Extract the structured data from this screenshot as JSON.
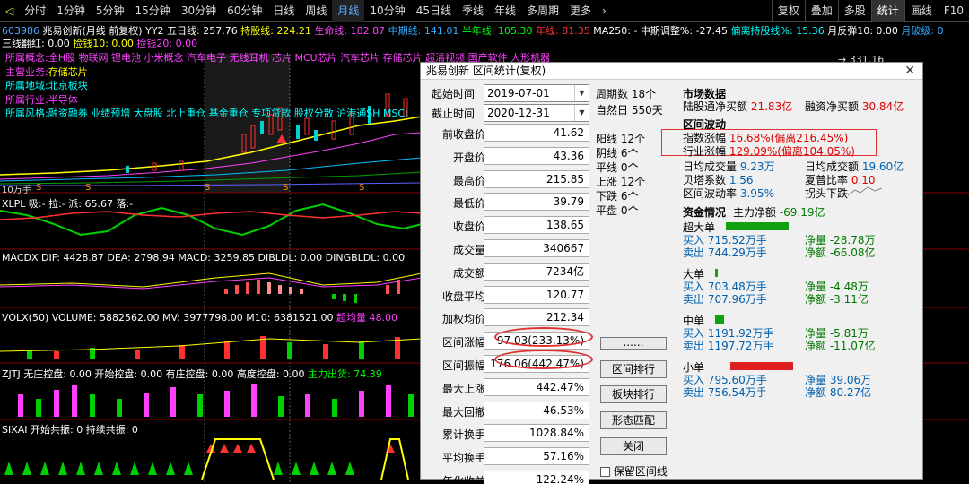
{
  "toolbar": {
    "tabs": [
      "分时",
      "1分钟",
      "5分钟",
      "15分钟",
      "30分钟",
      "60分钟",
      "日线",
      "周线",
      "月线",
      "10分钟",
      "45日线",
      "季线",
      "年线",
      "多周期",
      "更多"
    ],
    "active": "月线",
    "right": [
      "复权",
      "叠加",
      "多股",
      "统计",
      "画线",
      "F10"
    ]
  },
  "stock": {
    "code": "603986",
    "name": "兆易创新(月线 前复权)",
    "ma_label": "YY2",
    "ma5": "五日线: 257.76",
    "hold": "持股线: 224.21",
    "life": "生命线: 182.87",
    "mid": "中期线: 141.01",
    "half": "半年线: 105.30",
    "year": "年线: 81.35",
    "ma250": "MA250: - 中期调整%: -27.45",
    "bias": "偏离持股线%: 15.36",
    "month_reverse": "月反弹10: 0.00",
    "brk": "月破级: 0",
    "signal": "三线翻红: 0.00",
    "pick": "捡钱10: 0.00",
    "pick20": "捡钱20: 0.00",
    "price_mark": "331.16"
  },
  "info": {
    "concept_label": "所属概念:",
    "concept": "全H股 物联网 锂电池 小米概念 汽车电子 无线耳机 芯片 MCU芯片 汽车芯片 存储芯片 超清视频 国产软件 人形机器",
    "biz_label": "主营业务:",
    "biz": "存储芯片",
    "region_label": "所属地域:",
    "region": "北京板块",
    "industry_label": "所属行业:",
    "industry": "半导体",
    "style_label": "所属风格:",
    "style": "融资融券 业绩预增 大盘股 北上重仓 基金重仓 专项贷款 股权分散 沪港通SH MSCI"
  },
  "indicators": {
    "xlpl": "XLPL 吸:- 拉:- 派: 65.67 落:-",
    "macd": "MACDX DIF: 4428.87 DEA: 2798.94 MACD: 3259.85 DIBLDL: 0.00 DINGBLDL: 0.00",
    "volx": "VOLX(50) VOLUME: 5882562.00 MV: 3977798.00 M10: 6381521.00",
    "volx_extra": "超均量 48.00",
    "zjtj": "ZJTJ 无庄控盘: 0.00 开始控盘: 0.00 有庄控盘: 0.00 高度控盘: 0.00",
    "zjtj_extra": "主力出货: 74.39",
    "sixai": "SIXAI 开始共振: 0 持续共振: 0"
  },
  "axis": {
    "yleft": "10万手"
  },
  "dialog": {
    "title": "兆易创新 区间统计(复权)",
    "start_label": "起始时间",
    "start_value": "2019-07-01",
    "end_label": "截止时间",
    "end_value": "2020-12-31",
    "fields": [
      {
        "label": "前收盘价",
        "value": "41.62"
      },
      {
        "label": "开盘价",
        "value": "43.36"
      },
      {
        "label": "最高价",
        "value": "215.85"
      },
      {
        "label": "最低价",
        "value": "39.79"
      },
      {
        "label": "收盘价",
        "value": "138.65"
      },
      {
        "label": "成交量",
        "value": "340667"
      },
      {
        "label": "成交额",
        "value": "7234亿"
      },
      {
        "label": "收盘平均",
        "value": "120.77"
      },
      {
        "label": "加权均价",
        "value": "212.34"
      },
      {
        "label": "区间涨幅",
        "value": "97.03(233.13%)"
      },
      {
        "label": "区间振幅",
        "value": "176.06(442.47%)"
      },
      {
        "label": "最大上涨",
        "value": "442.47%"
      },
      {
        "label": "最大回撤",
        "value": "-46.53%"
      },
      {
        "label": "累计换手",
        "value": "1028.84%"
      },
      {
        "label": "平均换手",
        "value": "57.16%"
      },
      {
        "label": "年化收益",
        "value": "122.24%"
      }
    ],
    "periods": "周期数 18个",
    "natural_days": "自然日 550天",
    "counts": [
      "阳线 12个",
      "阴线 6个",
      "平线 0个",
      "上涨 12个",
      "下跌 6个",
      "平盘 0个"
    ],
    "buttons": [
      "......",
      "区间排行",
      "板块排行",
      "形态匹配",
      "关闭"
    ],
    "checkbox": "保留区间线",
    "market_title": "市场数据",
    "margin_buy": "陆股通净买额",
    "margin_buy_val": "21.83亿",
    "fin_buy": "融资净买额",
    "fin_buy_val": "30.84亿",
    "range_title": "区间波动",
    "idx_label": "指数涨幅",
    "idx_val": "16.68%(偏离216.45%)",
    "ind_label": "行业涨幅",
    "ind_val": "129.09%(偏离104.05%)",
    "avg_vol_label": "日均成交量",
    "avg_vol": "9.23万",
    "avg_amt_label": "日均成交额",
    "avg_amt": "19.60亿",
    "beta_label": "贝塔系数",
    "beta": "1.56",
    "sharpe_label": "夏普比率",
    "sharpe": "0.10",
    "vol_label": "区间波动率",
    "vol": "3.95%",
    "inflect": "拐头下跌",
    "fund_title": "资金情况",
    "main_label": "主力净额",
    "main_val": "-69.19亿",
    "groups": [
      {
        "name": "超大单",
        "buy": "买入 715.52万手",
        "sell": "卖出 744.29万手",
        "net1": "净量 -28.78万",
        "net2": "净额 -66.08亿",
        "color": "#10a010",
        "bw": 70
      },
      {
        "name": "大单",
        "buy": "买入 703.48万手",
        "sell": "卖出 707.96万手",
        "net1": "净量 -4.48万",
        "net2": "净额 -3.11亿",
        "color": "#10a010",
        "bw": 3
      },
      {
        "name": "中单",
        "buy": "买入 1191.92万手",
        "sell": "卖出 1197.72万手",
        "net1": "净量 -5.81万",
        "net2": "净额 -11.07亿",
        "color": "#10a010",
        "bw": 10
      },
      {
        "name": "小单",
        "buy": "买入 795.60万手",
        "sell": "卖出 756.54万手",
        "net1": "净量 39.06万",
        "net2": "净额 80.27亿",
        "color": "#e02020",
        "bw": 70
      }
    ]
  },
  "colors": {
    "bg": "#000000",
    "red": "#ff3030",
    "green": "#00d000",
    "yellow": "#ffff00",
    "cyan": "#00ffff",
    "magenta": "#ff40ff"
  }
}
